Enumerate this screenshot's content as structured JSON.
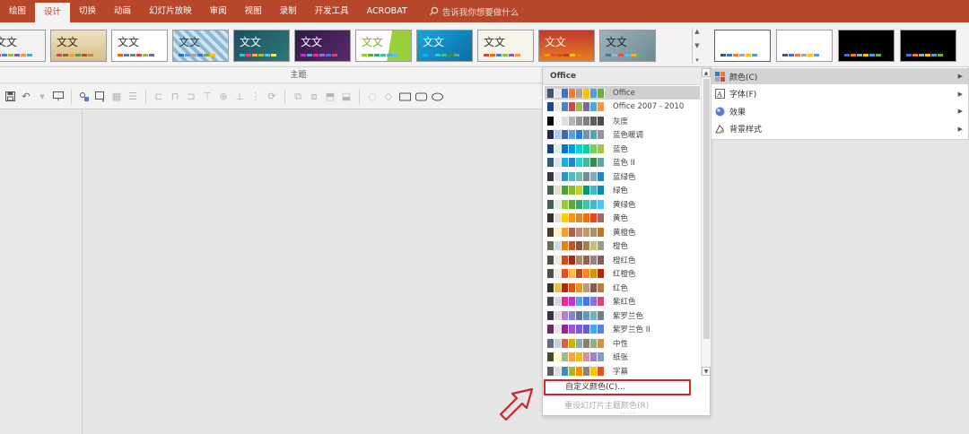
{
  "ribbon_tabs": [
    "绘图",
    "设计",
    "切换",
    "动画",
    "幻灯片放映",
    "审阅",
    "视图",
    "录制",
    "开发工具",
    "ACROBAT"
  ],
  "active_tab": "设计",
  "tell_me": "告诉我你想要做什么",
  "theme_sample_text": "文文",
  "group_label": "主题",
  "colors_menu": {
    "header": "Office",
    "schemes": [
      {
        "name": "Office",
        "colors": [
          "#44546a",
          "#e7e6e6",
          "#4472c4",
          "#ed7d31",
          "#a5a5a5",
          "#ffc000",
          "#5b9bd5",
          "#70ad47"
        ]
      },
      {
        "name": "Office 2007 - 2010",
        "colors": [
          "#1f497d",
          "#eeece1",
          "#4f81bd",
          "#c0504d",
          "#9bbb59",
          "#8064a2",
          "#4bacc6",
          "#f79646"
        ]
      },
      {
        "name": "灰度",
        "colors": [
          "#000000",
          "#f8f8f8",
          "#dddddd",
          "#b2b2b2",
          "#969696",
          "#808080",
          "#5f5f5f",
          "#4d4d4d"
        ]
      },
      {
        "name": "蓝色暖调",
        "colors": [
          "#242852",
          "#acccea",
          "#4a66ac",
          "#629dd1",
          "#297fd5",
          "#7f8fa9",
          "#5aa2ae",
          "#9d90a0"
        ]
      },
      {
        "name": "蓝色",
        "colors": [
          "#17406d",
          "#dbefd9",
          "#0f6fc6",
          "#009dd9",
          "#0bd0d9",
          "#10cf9b",
          "#7cca62",
          "#a5c249"
        ]
      },
      {
        "name": "蓝色 II",
        "colors": [
          "#335b74",
          "#dfe3e5",
          "#1cade4",
          "#2683c6",
          "#27ced7",
          "#42ba97",
          "#3e8853",
          "#62a39f"
        ]
      },
      {
        "name": "蓝绿色",
        "colors": [
          "#373545",
          "#dee7e6",
          "#3494ba",
          "#58b6c0",
          "#75bda7",
          "#7a8c8e",
          "#84acb6",
          "#2683c6"
        ]
      },
      {
        "name": "绿色",
        "colors": [
          "#455f51",
          "#e3ded1",
          "#549e39",
          "#8ab833",
          "#c0cf3a",
          "#029676",
          "#4ab5c4",
          "#0989b1"
        ]
      },
      {
        "name": "黄绿色",
        "colors": [
          "#455f51",
          "#e4e9ec",
          "#99cb38",
          "#63a537",
          "#37a76f",
          "#44c1a3",
          "#4eb3cf",
          "#51c3f9"
        ]
      },
      {
        "name": "黄色",
        "colors": [
          "#39302a",
          "#e5dedb",
          "#ffca08",
          "#f8931d",
          "#ce8d3e",
          "#ec7016",
          "#e64823",
          "#9c6a6a"
        ]
      },
      {
        "name": "黄橙色",
        "colors": [
          "#4e3b30",
          "#fbeec9",
          "#f0a22e",
          "#a5644e",
          "#b58b80",
          "#c3986d",
          "#a19574",
          "#c17529"
        ]
      },
      {
        "name": "橙色",
        "colors": [
          "#637052",
          "#ccddea",
          "#e48312",
          "#bd582c",
          "#865640",
          "#9b8357",
          "#c2bc80",
          "#94a088"
        ]
      },
      {
        "name": "橙红色",
        "colors": [
          "#505046",
          "#eeece1",
          "#d34817",
          "#9b2d1f",
          "#a28e6a",
          "#956251",
          "#918485",
          "#855d5d"
        ]
      },
      {
        "name": "红橙色",
        "colors": [
          "#505046",
          "#eeece1",
          "#e84c22",
          "#ffbd47",
          "#b64926",
          "#ff8427",
          "#cc9900",
          "#b22600"
        ]
      },
      {
        "name": "红色",
        "colors": [
          "#323232",
          "#e5c243",
          "#a5300f",
          "#d55816",
          "#e19825",
          "#b19c7d",
          "#7f5f52",
          "#b27d49"
        ]
      },
      {
        "name": "紫红色",
        "colors": [
          "#454551",
          "#d8d9dc",
          "#e32d91",
          "#c830cc",
          "#4ea6dc",
          "#4775e7",
          "#8971e1",
          "#d54773"
        ]
      },
      {
        "name": "紫罗兰色",
        "colors": [
          "#373545",
          "#dcd8dc",
          "#ad84c6",
          "#8784c7",
          "#5d739a",
          "#6997af",
          "#84acb6",
          "#6f8183"
        ]
      },
      {
        "name": "紫罗兰色 II",
        "colors": [
          "#632e62",
          "#eae5eb",
          "#92278f",
          "#9b57d3",
          "#755dd9",
          "#665eb8",
          "#45a5ed",
          "#5982db"
        ]
      },
      {
        "name": "中性",
        "colors": [
          "#646b86",
          "#c5d1d7",
          "#d16349",
          "#ccb400",
          "#8cadae",
          "#8c7b70",
          "#8fb08c",
          "#d19049"
        ]
      },
      {
        "name": "纸张",
        "colors": [
          "#444d26",
          "#fefac9",
          "#a5b592",
          "#f3a447",
          "#e7bc29",
          "#d092a7",
          "#9c85c0",
          "#809ec2"
        ]
      },
      {
        "name": "字幕",
        "colors": [
          "#5e5e5e",
          "#ddddde",
          "#418ab3",
          "#a6b727",
          "#f69200",
          "#838383",
          "#fec306",
          "#df5327"
        ]
      }
    ],
    "custom_colors": "自定义颜色(C)...",
    "reset_colors": "重设幻灯片主题颜色(R)"
  },
  "variant_menu": [
    {
      "label": "颜色(C)",
      "icon": "palette-icon",
      "highlighted": true
    },
    {
      "label": "字体(F)",
      "icon": "font-icon",
      "highlighted": false
    },
    {
      "label": "效果",
      "icon": "effects-icon",
      "highlighted": false
    },
    {
      "label": "背景样式",
      "icon": "background-style-icon",
      "highlighted": false
    }
  ]
}
